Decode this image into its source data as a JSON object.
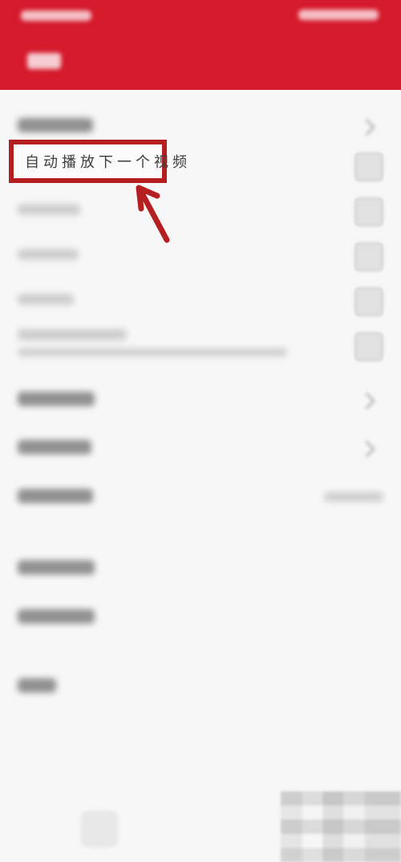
{
  "highlight": {
    "label": "自动播放下一个视频"
  },
  "colors": {
    "header": "#d51a2c",
    "annotation": "#b61f21"
  },
  "icons": {
    "arrow": "arrow-up-left-icon"
  }
}
